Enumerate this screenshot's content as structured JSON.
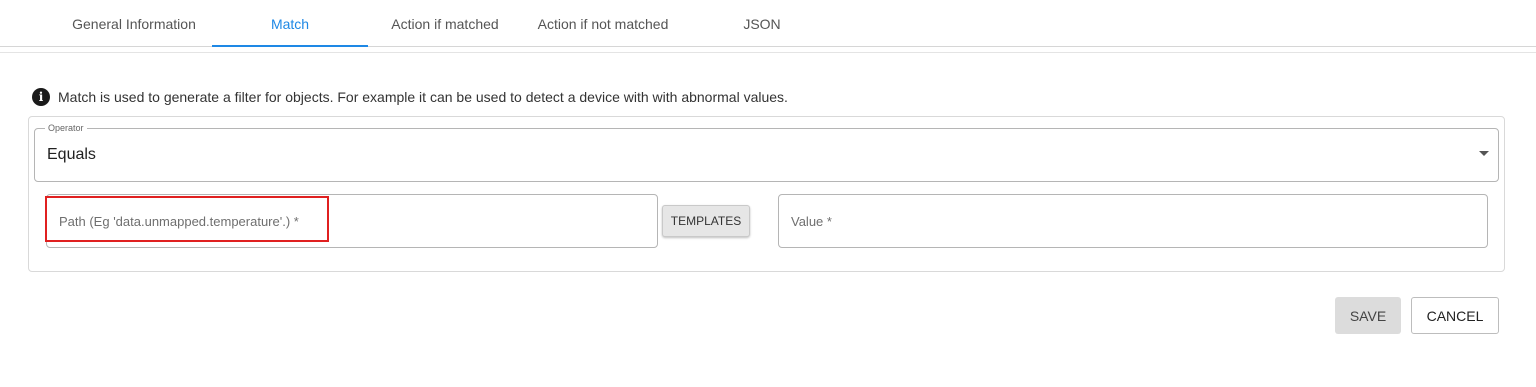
{
  "tabs": [
    {
      "label": "General Information"
    },
    {
      "label": "Match"
    },
    {
      "label": "Action if matched"
    },
    {
      "label": "Action if not matched"
    },
    {
      "label": "JSON"
    }
  ],
  "active_tab": "Match",
  "info": {
    "icon": "info-icon",
    "text": "Match is used to generate a filter for objects. For example it can be used to detect a device with with abnormal values."
  },
  "operator": {
    "legend": "Operator",
    "value": "Equals"
  },
  "path_field": {
    "placeholder": "Path (Eg 'data.unmapped.temperature'.) *",
    "value": ""
  },
  "templates_label": "TEMPLATES",
  "value_field": {
    "placeholder": "Value *",
    "value": ""
  },
  "actions": {
    "save_label": "SAVE",
    "cancel_label": "CANCEL"
  },
  "colors": {
    "accent": "#1e88e5",
    "highlight": "#e02020"
  }
}
